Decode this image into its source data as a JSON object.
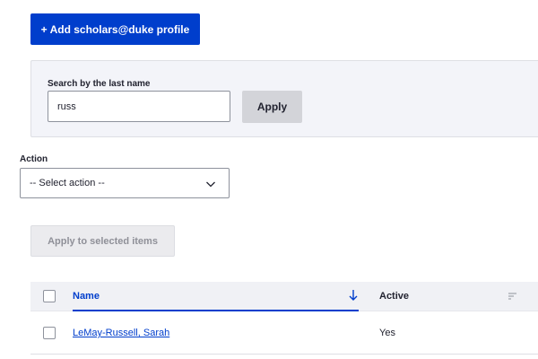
{
  "toolbar": {
    "add_label": "+ Add scholars@duke profile"
  },
  "filter": {
    "label": "Search by the last name",
    "value": "russ",
    "apply_label": "Apply"
  },
  "bulk": {
    "action_label": "Action",
    "select_value": "-- Select action --",
    "apply_label": "Apply to selected items"
  },
  "table": {
    "columns": [
      {
        "label": "Name",
        "sorted": "descending"
      },
      {
        "label": "Active",
        "sortable": true
      }
    ],
    "rows": [
      {
        "name": "LeMay-Russell, Sarah",
        "active": "Yes",
        "selected": false
      }
    ]
  },
  "colors": {
    "primary": "#003ecc",
    "text": "#222330"
  }
}
